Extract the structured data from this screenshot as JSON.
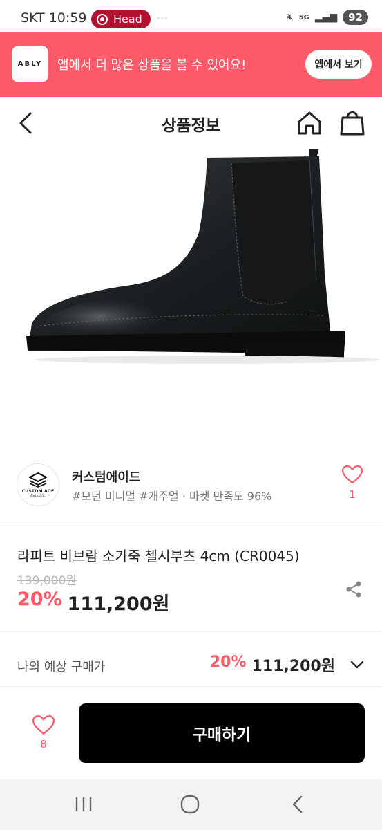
{
  "status_bar": {
    "carrier": "SKT",
    "time": "10:59",
    "recording_label": "Head",
    "network": "5G",
    "battery": "92"
  },
  "ably_banner": {
    "logo_text": "ABLY",
    "message": "앱에서 더 많은 상품을 볼 수 있어요!",
    "button_label": "앱에서 보기"
  },
  "header": {
    "title": "상품정보"
  },
  "seller": {
    "avatar_text": "CUSTOM ADE",
    "avatar_subtext": "Republic",
    "name": "커스텀에이드",
    "tags": "#모던 미니멀 #캐주얼 · 마켓 만족도 96%",
    "like_count": "1"
  },
  "product": {
    "name": "라피트 비브람 소가죽 첼시부츠 4cm (CR0045)",
    "original_price": "139,000원",
    "discount": "20%",
    "price": "111,200원"
  },
  "expected": {
    "label": "나의 예상 구매가",
    "discount": "20%",
    "price": "111,200원"
  },
  "bottom_bar": {
    "like_count": "8",
    "buy_label": "구매하기"
  },
  "colors": {
    "accent": "#ff5a6a",
    "buy_button": "#000000",
    "recording_pill": "#b2122f"
  }
}
